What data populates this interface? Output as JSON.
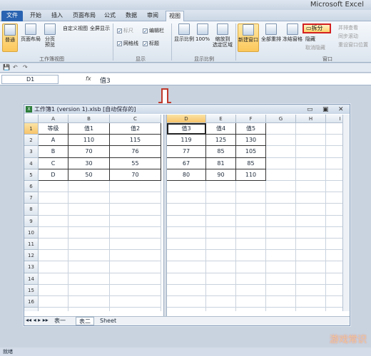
{
  "app": {
    "title": "Microsoft Excel"
  },
  "tabs": [
    "文件",
    "开始",
    "插入",
    "页面布局",
    "公式",
    "数据",
    "审阅",
    "视图"
  ],
  "ribbon": {
    "normal": "普通",
    "page_layout": "页面布局",
    "page_break": "分页\n预览",
    "custom_view": "自定义视图",
    "full_screen": "全屏显示",
    "group_views": "工作簿视图",
    "ruler": "标尺",
    "gridlines": "网格线",
    "formula_bar": "编辑栏",
    "headings": "标题",
    "group_show": "显示",
    "zoom": "显示比例",
    "zoom100": "100%",
    "zoom_sel": "缩放到\n选定区域",
    "group_zoom": "显示比例",
    "new_window": "新建窗口",
    "arrange_all": "全部重排",
    "freeze": "冻结窗格",
    "split": "拆分",
    "hide": "隐藏",
    "unhide": "取消隐藏",
    "side_by_side": "并排查看",
    "sync_scroll": "同步滚动",
    "reset_pos": "重设窗口位置",
    "group_window": "窗口"
  },
  "formula_bar": {
    "name_box": "D1",
    "fx": "fx",
    "value": "值3"
  },
  "workbook": {
    "title": "工作簿1 (version 1).xlsb [自动保存的]",
    "left_cols": [
      "A",
      "B",
      "C"
    ],
    "right_cols": [
      "D",
      "E",
      "F",
      "G",
      "H",
      "I"
    ],
    "rows": [
      "1",
      "2",
      "3",
      "4",
      "5",
      "6",
      "7",
      "8",
      "9",
      "10",
      "11",
      "12",
      "13",
      "14",
      "15",
      "16",
      "17",
      "18"
    ],
    "left_data": [
      [
        "等级",
        "值1",
        "值2"
      ],
      [
        "A",
        "110",
        "115"
      ],
      [
        "B",
        "70",
        "76"
      ],
      [
        "C",
        "30",
        "55"
      ],
      [
        "D",
        "50",
        "70"
      ]
    ],
    "right_data": [
      [
        "值3",
        "值4",
        "值5"
      ],
      [
        "119",
        "125",
        "130"
      ],
      [
        "77",
        "85",
        "105"
      ],
      [
        "67",
        "81",
        "85"
      ],
      [
        "80",
        "90",
        "110"
      ]
    ],
    "sheets": [
      "表一",
      "表二",
      "Sheet"
    ]
  },
  "status": {
    "left": "就绪"
  },
  "watermark": "游戏常识",
  "colors": {
    "file_tab": "#2a63b1",
    "split_highlight": "#d42020",
    "arrow": "#c0392b"
  }
}
